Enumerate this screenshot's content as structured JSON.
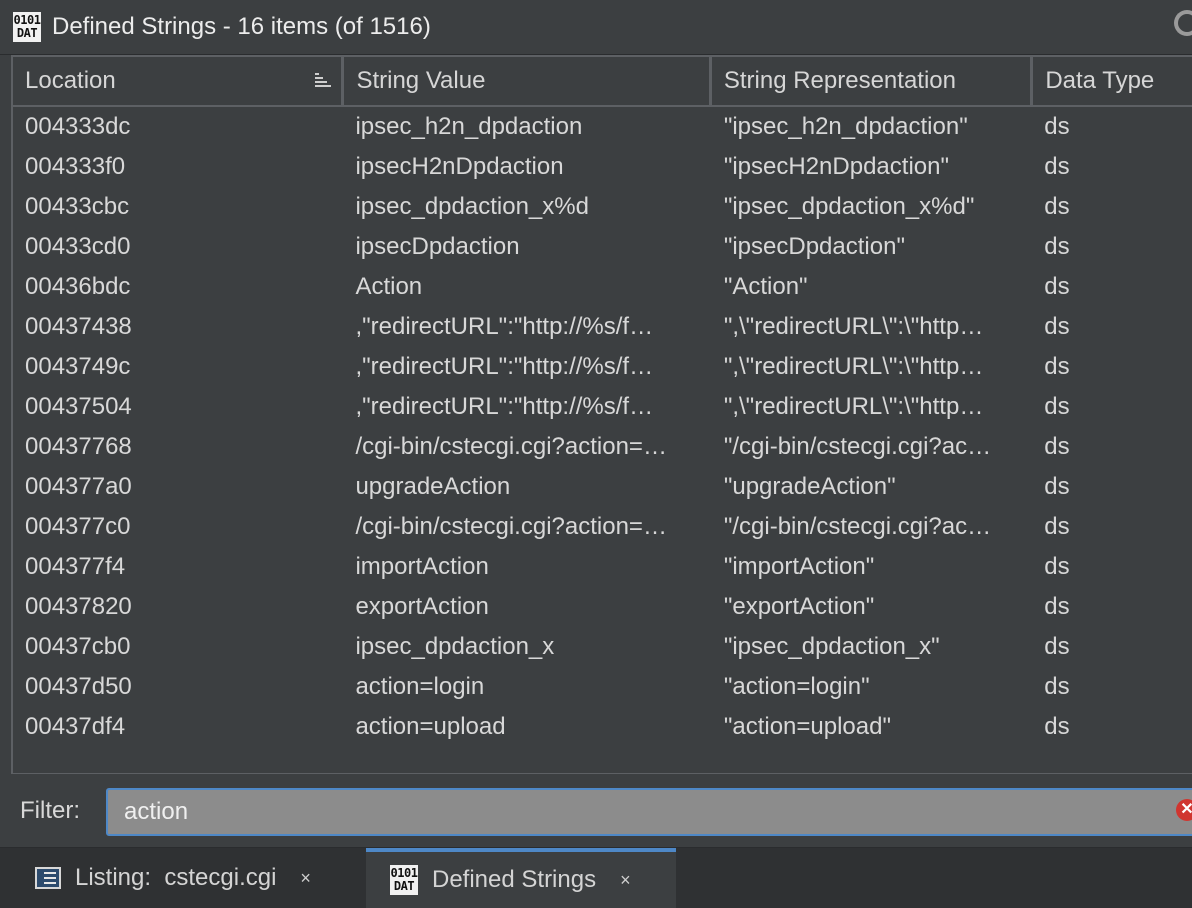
{
  "window": {
    "icon_text_top": "0101",
    "icon_text_bottom": "DAT",
    "title": "Defined Strings - 16 items (of 1516)"
  },
  "columns": {
    "location": "Location",
    "string_value": "String Value",
    "string_representation": "String Representation",
    "data_type": "Data Type"
  },
  "rows": [
    {
      "location": "004333dc",
      "value": "ipsec_h2n_dpdaction",
      "repr": "\"ipsec_h2n_dpdaction\"",
      "type": "ds"
    },
    {
      "location": "004333f0",
      "value": "ipsecH2nDpdaction",
      "repr": "\"ipsecH2nDpdaction\"",
      "type": "ds"
    },
    {
      "location": "00433cbc",
      "value": "ipsec_dpdaction_x%d",
      "repr": "\"ipsec_dpdaction_x%d\"",
      "type": "ds"
    },
    {
      "location": "00433cd0",
      "value": "ipsecDpdaction",
      "repr": "\"ipsecDpdaction\"",
      "type": "ds"
    },
    {
      "location": "00436bdc",
      "value": "Action",
      "repr": "\"Action\"",
      "type": "ds"
    },
    {
      "location": "00437438",
      "value": ",\"redirectURL\":\"http://%s/f…",
      "repr": "\",\\\"redirectURL\\\":\\\"http…",
      "type": "ds"
    },
    {
      "location": "0043749c",
      "value": ",\"redirectURL\":\"http://%s/f…",
      "repr": "\",\\\"redirectURL\\\":\\\"http…",
      "type": "ds"
    },
    {
      "location": "00437504",
      "value": ",\"redirectURL\":\"http://%s/f…",
      "repr": "\",\\\"redirectURL\\\":\\\"http…",
      "type": "ds"
    },
    {
      "location": "00437768",
      "value": "/cgi-bin/cstecgi.cgi?action=…",
      "repr": "\"/cgi-bin/cstecgi.cgi?ac…",
      "type": "ds"
    },
    {
      "location": "004377a0",
      "value": "upgradeAction",
      "repr": "\"upgradeAction\"",
      "type": "ds"
    },
    {
      "location": "004377c0",
      "value": "/cgi-bin/cstecgi.cgi?action=…",
      "repr": "\"/cgi-bin/cstecgi.cgi?ac…",
      "type": "ds"
    },
    {
      "location": "004377f4",
      "value": "importAction",
      "repr": "\"importAction\"",
      "type": "ds"
    },
    {
      "location": "00437820",
      "value": "exportAction",
      "repr": "\"exportAction\"",
      "type": "ds"
    },
    {
      "location": "00437cb0",
      "value": "ipsec_dpdaction_x",
      "repr": "\"ipsec_dpdaction_x\"",
      "type": "ds"
    },
    {
      "location": "00437d50",
      "value": "action=login",
      "repr": "\"action=login\"",
      "type": "ds"
    },
    {
      "location": "00437df4",
      "value": "action=upload",
      "repr": "\"action=upload\"",
      "type": "ds"
    }
  ],
  "filter": {
    "label": "Filter:",
    "value": "action"
  },
  "tabs": [
    {
      "label": "Listing:  cstecgi.cgi",
      "close": "×",
      "active": false
    },
    {
      "label": "Defined Strings",
      "close": "×",
      "active": true
    }
  ],
  "colors": {
    "accent": "#4e88c7",
    "background": "#3c3f41",
    "clear": "#d0352f"
  },
  "icons": {
    "sort": "sort-ascending-icon",
    "refresh": "refresh-icon",
    "clear": "clear-filter-icon",
    "listing": "listing-icon",
    "strings": "defined-strings-icon"
  }
}
